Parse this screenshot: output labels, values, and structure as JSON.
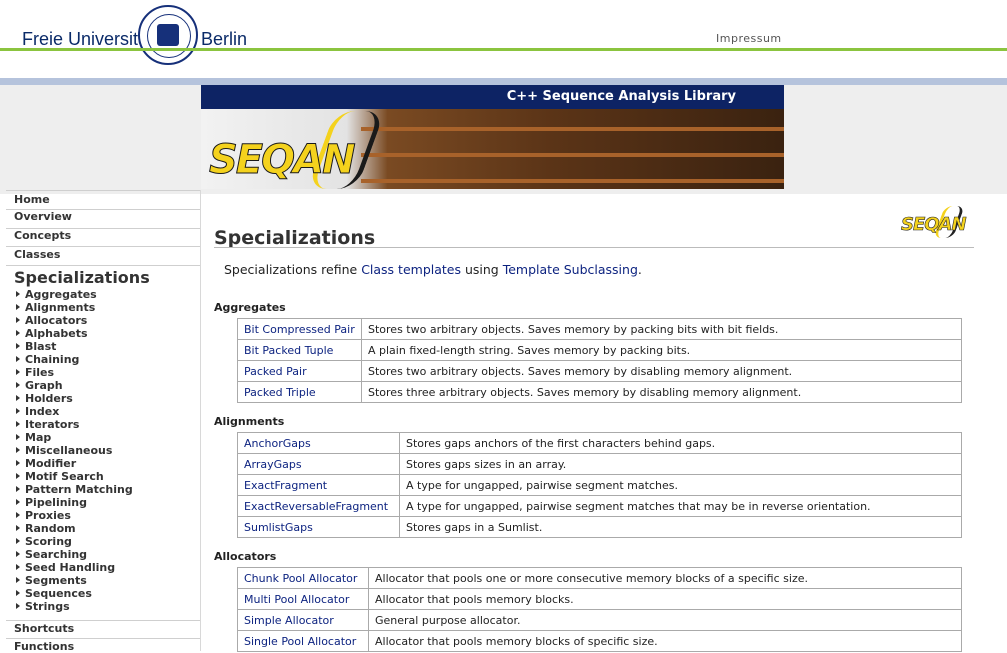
{
  "header": {
    "brand_left": "Freie Universität",
    "brand_right": "Berlin",
    "impressum": "Impressum"
  },
  "banner": {
    "title": "C++ Sequence Analysis Library",
    "logo_text": "SEQAN"
  },
  "sidebar": {
    "home": "Home",
    "overview": "Overview",
    "concepts": "Concepts",
    "classes": "Classes",
    "specializations": "Specializations",
    "subitems": [
      "Aggregates",
      "Alignments",
      "Allocators",
      "Alphabets",
      "Blast",
      "Chaining",
      "Files",
      "Graph",
      "Holders",
      "Index",
      "Iterators",
      "Map",
      "Miscellaneous",
      "Modifier",
      "Motif Search",
      "Pattern Matching",
      "Pipelining",
      "Proxies",
      "Random",
      "Scoring",
      "Searching",
      "Seed Handling",
      "Segments",
      "Sequences",
      "Strings"
    ],
    "shortcuts": "Shortcuts",
    "functions": "Functions"
  },
  "main": {
    "title": "Specializations",
    "small_logo": "SEQAN",
    "intro_pre": "Specializations refine ",
    "intro_link1": "Class templates",
    "intro_mid": " using ",
    "intro_link2": "Template Subclassing",
    "intro_post": ".",
    "sections": [
      {
        "heading": "Aggregates",
        "rows": [
          {
            "name": "Bit Compressed Pair",
            "desc": "Stores two arbitrary objects. Saves memory by packing bits with bit fields."
          },
          {
            "name": "Bit Packed Tuple",
            "desc": "A plain fixed-length string. Saves memory by packing bits."
          },
          {
            "name": "Packed Pair",
            "desc": "Stores two arbitrary objects. Saves memory by disabling memory alignment."
          },
          {
            "name": "Packed Triple",
            "desc": "Stores three arbitrary objects. Saves memory by disabling memory alignment."
          }
        ]
      },
      {
        "heading": "Alignments",
        "rows": [
          {
            "name": "AnchorGaps",
            "desc": "Stores gaps anchors of the first characters behind gaps."
          },
          {
            "name": "ArrayGaps",
            "desc": "Stores gaps sizes in an array."
          },
          {
            "name": "ExactFragment",
            "desc": "A type for ungapped, pairwise segment matches."
          },
          {
            "name": "ExactReversableFragment",
            "desc": "A type for ungapped, pairwise segment matches that may be in reverse orientation."
          },
          {
            "name": "SumlistGaps",
            "desc": "Stores gaps in a Sumlist."
          }
        ]
      },
      {
        "heading": "Allocators",
        "rows": [
          {
            "name": "Chunk Pool Allocator",
            "desc": "Allocator that pools one or more consecutive memory blocks of a specific size."
          },
          {
            "name": "Multi Pool Allocator",
            "desc": "Allocator that pools memory blocks."
          },
          {
            "name": "Simple Allocator",
            "desc": "General purpose allocator."
          },
          {
            "name": "Single Pool Allocator",
            "desc": "Allocator that pools memory blocks of specific size."
          }
        ]
      }
    ]
  }
}
